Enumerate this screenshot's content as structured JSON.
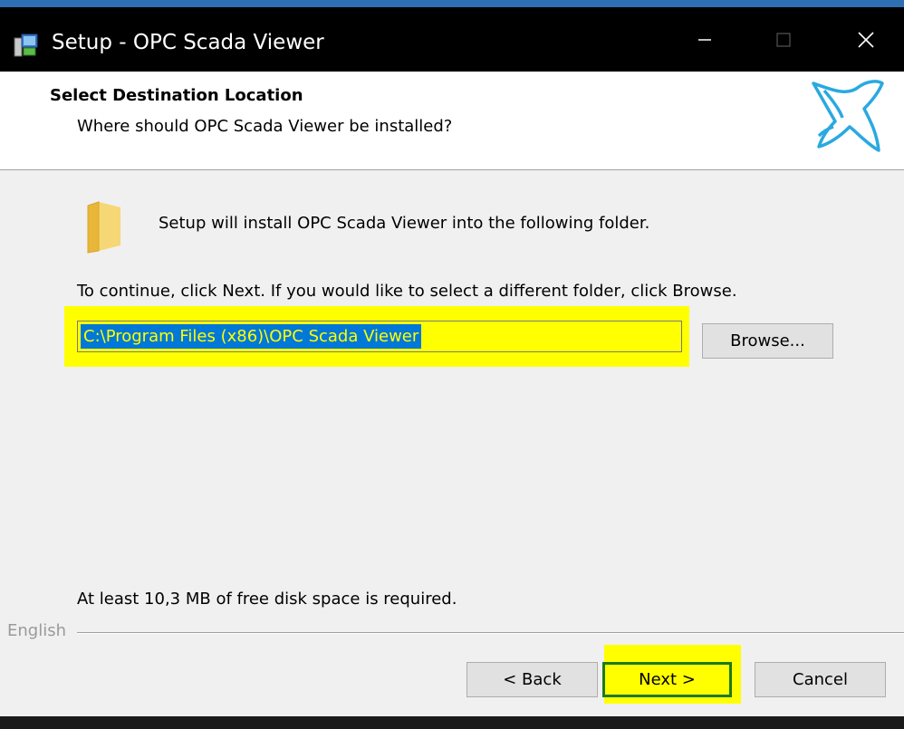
{
  "window": {
    "title": "Setup - OPC Scada Viewer",
    "controls": {
      "minimize": "minimize-icon",
      "maximize": "maximize-icon",
      "close": "close-icon"
    }
  },
  "header": {
    "title": "Select Destination Location",
    "subtitle": "Where should OPC Scada Viewer be installed?"
  },
  "body": {
    "intro": "Setup will install OPC Scada Viewer into the following folder.",
    "continue": "To continue, click Next. If you would like to select a different folder, click Browse.",
    "path_value": "C:\\Program Files (x86)\\OPC Scada Viewer",
    "browse_label": "Browse...",
    "disk_space": "At least 10,3 MB of free disk space is required."
  },
  "footer": {
    "language": "English",
    "back_label": "< Back",
    "next_label": "Next >",
    "cancel_label": "Cancel"
  },
  "colors": {
    "highlight": "#ffff00",
    "selection": "#0078d7",
    "next_border": "#1c7a1c",
    "logo": "#29a9e0"
  }
}
